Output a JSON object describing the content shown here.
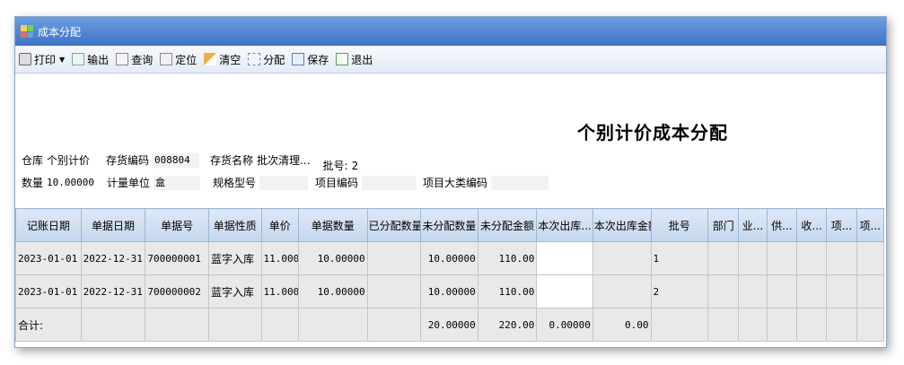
{
  "window": {
    "title": "成本分配"
  },
  "toolbar": {
    "items": [
      {
        "label": "打印",
        "icon": "printer-icon",
        "dropdown": true
      },
      {
        "label": "输出",
        "icon": "export-icon"
      },
      {
        "label": "查询",
        "icon": "query-icon"
      },
      {
        "label": "定位",
        "icon": "locate-icon"
      },
      {
        "label": "清空",
        "icon": "broom-icon"
      },
      {
        "label": "分配",
        "icon": "allocate-icon"
      },
      {
        "label": "保存",
        "icon": "save-icon"
      },
      {
        "label": "退出",
        "icon": "exit-icon"
      }
    ]
  },
  "header": {
    "title": "个别计价成本分配",
    "warehouse_label": "仓库",
    "warehouse_value": "个别计价",
    "inventory_code_label": "存货编码",
    "inventory_code_value": "008804",
    "inventory_name_label": "存货名称",
    "inventory_name_value": "批次清理...",
    "batch_label": "批号:",
    "batch_value": "2",
    "quantity_label": "数量",
    "quantity_value": "10.00000",
    "unit_label": "计量单位",
    "unit_value": "盒",
    "spec_label": "规格型号",
    "spec_value": "",
    "project_code_label": "项目编码",
    "project_code_value": "",
    "project_category_label": "项目大类编码",
    "project_category_value": ""
  },
  "grid": {
    "columns": [
      "记账日期",
      "单据日期",
      "单据号",
      "单据性质",
      "单价",
      "单据数量",
      "已分配数量",
      "未分配数量",
      "未分配金额",
      "本次出库...",
      "本次出库金额",
      "批号",
      "部门",
      "业...",
      "供...",
      "收...",
      "项...",
      "项..."
    ],
    "rows": [
      [
        "2023-01-01",
        "2022-12-31",
        "700000001",
        "蓝字入库",
        "11.000",
        "10.00000",
        "",
        "10.00000",
        "110.00",
        "",
        "",
        "1",
        "",
        "",
        "",
        "",
        "",
        ""
      ],
      [
        "2023-01-01",
        "2022-12-31",
        "700000002",
        "蓝字入库",
        "11.000",
        "10.00000",
        "",
        "10.00000",
        "110.00",
        "",
        "",
        "2",
        "",
        "",
        "",
        "",
        "",
        ""
      ]
    ],
    "total_row": [
      "合计:",
      "",
      "",
      "",
      "",
      "",
      "",
      "20.00000",
      "220.00",
      "0.00000",
      "0.00",
      "",
      "",
      "",
      "",
      "",
      "",
      ""
    ]
  },
  "colors": {
    "titlebar": "#3d72c8",
    "grid_header": "#c6d7ee",
    "cell_bg": "#e9e9e9"
  }
}
